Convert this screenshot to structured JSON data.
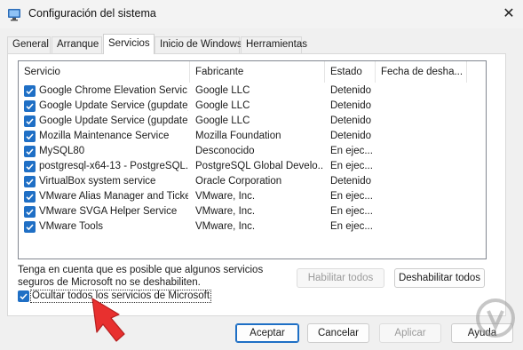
{
  "window": {
    "title": "Configuración del sistema",
    "close_glyph": "✕"
  },
  "tabs": [
    {
      "label": "General"
    },
    {
      "label": "Arranque"
    },
    {
      "label": "Servicios"
    },
    {
      "label": "Inicio de Windows"
    },
    {
      "label": "Herramientas"
    }
  ],
  "active_tab": "Servicios",
  "services": {
    "columns": [
      "Servicio",
      "Fabricante",
      "Estado",
      "Fecha de desha..."
    ],
    "rows": [
      {
        "checked": true,
        "name": "Google Chrome Elevation Servic...",
        "maker": "Google LLC",
        "status": "Detenido"
      },
      {
        "checked": true,
        "name": "Google Update Service (gupdate)",
        "maker": "Google LLC",
        "status": "Detenido"
      },
      {
        "checked": true,
        "name": "Google Update Service (gupdatem)",
        "maker": "Google LLC",
        "status": "Detenido"
      },
      {
        "checked": true,
        "name": "Mozilla Maintenance Service",
        "maker": "Mozilla Foundation",
        "status": "Detenido"
      },
      {
        "checked": true,
        "name": "MySQL80",
        "maker": "Desconocido",
        "status": "En ejec..."
      },
      {
        "checked": true,
        "name": "postgresql-x64-13 - PostgreSQL...",
        "maker": "PostgreSQL Global Develo...",
        "status": "En ejec..."
      },
      {
        "checked": true,
        "name": "VirtualBox system service",
        "maker": "Oracle Corporation",
        "status": "Detenido"
      },
      {
        "checked": true,
        "name": "VMware Alias Manager and Ticke...",
        "maker": "VMware, Inc.",
        "status": "En ejec..."
      },
      {
        "checked": true,
        "name": "VMware SVGA Helper Service",
        "maker": "VMware, Inc.",
        "status": "En ejec..."
      },
      {
        "checked": true,
        "name": "VMware Tools",
        "maker": "VMware, Inc.",
        "status": "En ejec..."
      }
    ]
  },
  "note": {
    "line1": "Tenga en cuenta que es posible que algunos servicios",
    "line2": "seguros de Microsoft no se deshabiliten."
  },
  "buttons": {
    "enable_all": "Habilitar todos",
    "disable_all": "Deshabilitar todos",
    "ok": "Aceptar",
    "cancel": "Cancelar",
    "apply": "Aplicar",
    "help": "Ayuda"
  },
  "hide_ms": {
    "checked": true,
    "label": "Ocultar todos los servicios de Microsoft"
  },
  "colors": {
    "accent": "#1f6fc5",
    "annotation_arrow": "#e8302f",
    "window_bg": "#f0f0f0"
  }
}
